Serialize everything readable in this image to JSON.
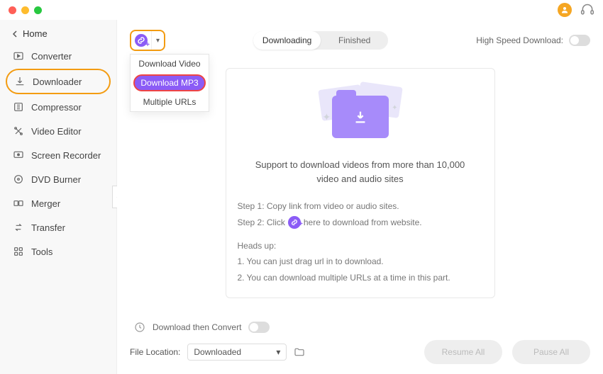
{
  "titlebar": {
    "close": "close",
    "minimize": "minimize",
    "zoom": "zoom"
  },
  "sidebar": {
    "home": "Home",
    "items": [
      {
        "label": "Converter"
      },
      {
        "label": "Downloader"
      },
      {
        "label": "Compressor"
      },
      {
        "label": "Video Editor"
      },
      {
        "label": "Screen Recorder"
      },
      {
        "label": "DVD Burner"
      },
      {
        "label": "Merger"
      },
      {
        "label": "Transfer"
      },
      {
        "label": "Tools"
      }
    ],
    "active_index": 1
  },
  "toolbar": {
    "segment": {
      "downloading": "Downloading",
      "finished": "Finished",
      "active": "downloading"
    },
    "high_speed_label": "High Speed Download:",
    "dropdown": {
      "items": [
        {
          "label": "Download Video"
        },
        {
          "label": "Download MP3"
        },
        {
          "label": "Multiple URLs"
        }
      ],
      "highlight_index": 1
    }
  },
  "card": {
    "title": "Support to download videos from more than 10,000 video and audio sites",
    "step1": "Step 1: Copy link from video or audio sites.",
    "step2_prefix": "Step 2: Click",
    "step2_suffix": "here to download from website.",
    "heads_up": "Heads up:",
    "tip1": "1. You can just drag url in to download.",
    "tip2": "2. You can download multiple URLs at a time in this part."
  },
  "footer": {
    "dtc_label": "Download then Convert",
    "file_location_label": "File Location:",
    "file_location_value": "Downloaded",
    "resume_all": "Resume All",
    "pause_all": "Pause All"
  }
}
